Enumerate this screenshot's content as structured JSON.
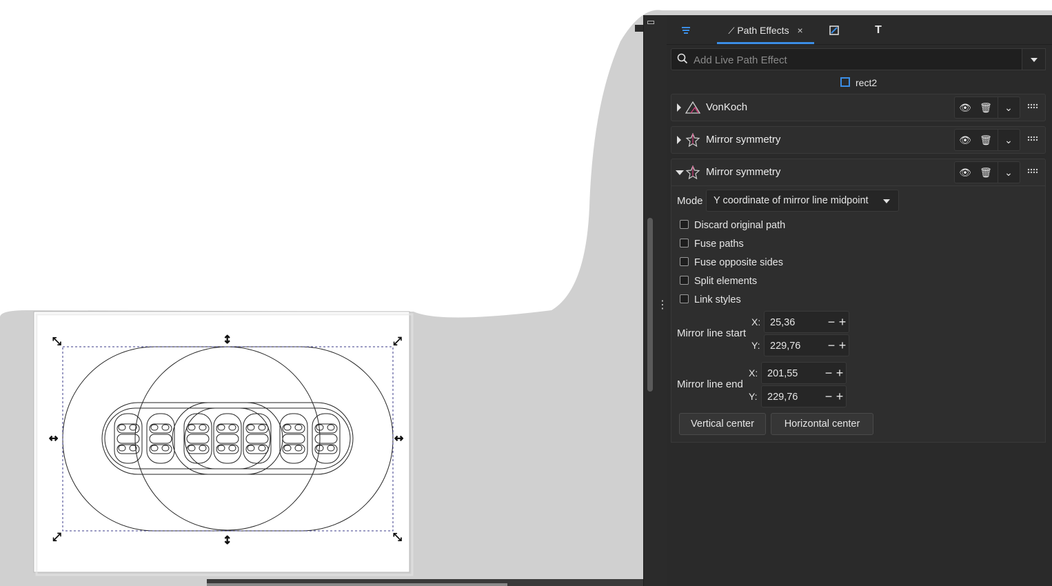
{
  "panel": {
    "tabs": [
      {
        "icon": "layers-icon"
      },
      {
        "label": "Path Effects",
        "icon": "path-effects-icon",
        "close": "×"
      },
      {
        "icon": "fill-stroke-icon"
      },
      {
        "icon": "text-icon",
        "glyph": "T"
      }
    ],
    "search": {
      "placeholder": "Add Live Path Effect"
    },
    "object": {
      "name": "rect2"
    },
    "effects": [
      {
        "name": "VonKoch",
        "icon": "vonkoch-icon",
        "expanded": false
      },
      {
        "name": "Mirror symmetry",
        "icon": "mirror-symmetry-icon",
        "expanded": false
      },
      {
        "name": "Mirror symmetry",
        "icon": "mirror-symmetry-icon",
        "expanded": true
      }
    ],
    "mirror": {
      "mode_label": "Mode",
      "mode_value": "Y coordinate of mirror line midpoint",
      "checkboxes": [
        {
          "label": "Discard original path",
          "checked": false
        },
        {
          "label": "Fuse paths",
          "checked": false
        },
        {
          "label": "Fuse opposite sides",
          "checked": false
        },
        {
          "label": "Split elements",
          "checked": false
        },
        {
          "label": "Link styles",
          "checked": false
        }
      ],
      "start_label": "Mirror line start",
      "end_label": "Mirror line end",
      "x_label": "X:",
      "y_label": "Y:",
      "start_x": "25,36",
      "start_y": "229,76",
      "end_x": "201,55",
      "end_y": "229,76",
      "minus": "−",
      "plus": "+",
      "vertical_center": "Vertical center",
      "horizontal_center": "Horizontal center"
    }
  },
  "colors": {
    "panel_bg": "#2a2a2a",
    "accent": "#3b8ee6",
    "canvas_gray": "#d0d0d0"
  }
}
